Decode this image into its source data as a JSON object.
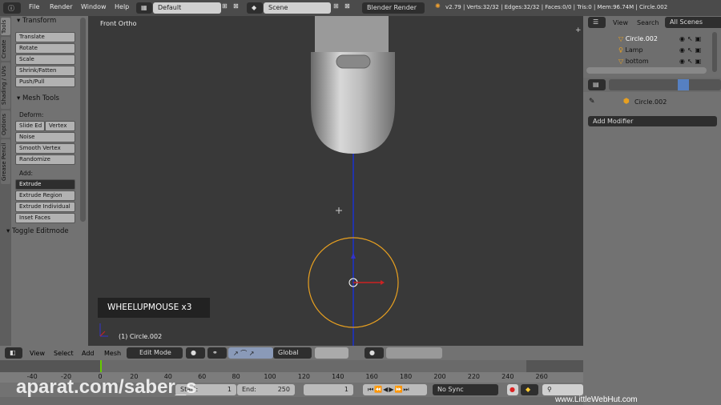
{
  "topbar": {
    "menus": [
      "File",
      "Render",
      "Window",
      "Help"
    ],
    "layout": "Default",
    "scene": "Scene",
    "engine": "Blender Render",
    "info": "v2.79 | Verts:32/32 | Edges:32/32 | Faces:0/0 | Tris:0 | Mem:96.74M | Circle.002"
  },
  "tool_tabs": [
    "Tools",
    "Create",
    "Shading / UVs",
    "Options",
    "Grease Pencil"
  ],
  "tools": {
    "transform_title": "Transform",
    "transform": [
      "Translate",
      "Rotate",
      "Scale",
      "Shrink/Fatten",
      "Push/Pull"
    ],
    "mesh_title": "Mesh Tools",
    "deform_label": "Deform:",
    "slide_edge": "Slide Ed",
    "vertex": "Vertex",
    "deform": [
      "Noise",
      "Smooth Vertex",
      "Randomize"
    ],
    "add_label": "Add:",
    "extrude": "Extrude",
    "add": [
      "Extrude Region",
      "Extrude Individual",
      "Inset Faces"
    ],
    "toggle": "Toggle Editmode"
  },
  "viewport": {
    "view_name": "Front Ortho",
    "key_overlay": "WHEELUPMOUSE x3",
    "object_label": "(1) Circle.002",
    "colors": {
      "circle": "#e8a020",
      "axis": "#2233aa"
    }
  },
  "view_header": {
    "menus": [
      "View",
      "Select",
      "Add",
      "Mesh"
    ],
    "mode": "Edit Mode",
    "orientation": "Global"
  },
  "timeline": {
    "ticks": [
      -40,
      -20,
      0,
      20,
      40,
      60,
      80,
      100,
      120,
      140,
      160,
      180,
      200,
      220,
      240,
      260
    ],
    "start_label": "Start:",
    "start": "1",
    "end_label": "End:",
    "end": "250",
    "current": "1",
    "sync": "No Sync"
  },
  "outliner": {
    "menus": [
      "View",
      "Search"
    ],
    "scope": "All Scenes",
    "items": [
      "Circle.002",
      "Lamp",
      "bottom"
    ]
  },
  "properties": {
    "object": "Circle.002",
    "add_modifier": "Add Modifier"
  },
  "watermarks": {
    "left": "aparat.com/saber_s",
    "right": "www.LittleWebHut.com"
  }
}
